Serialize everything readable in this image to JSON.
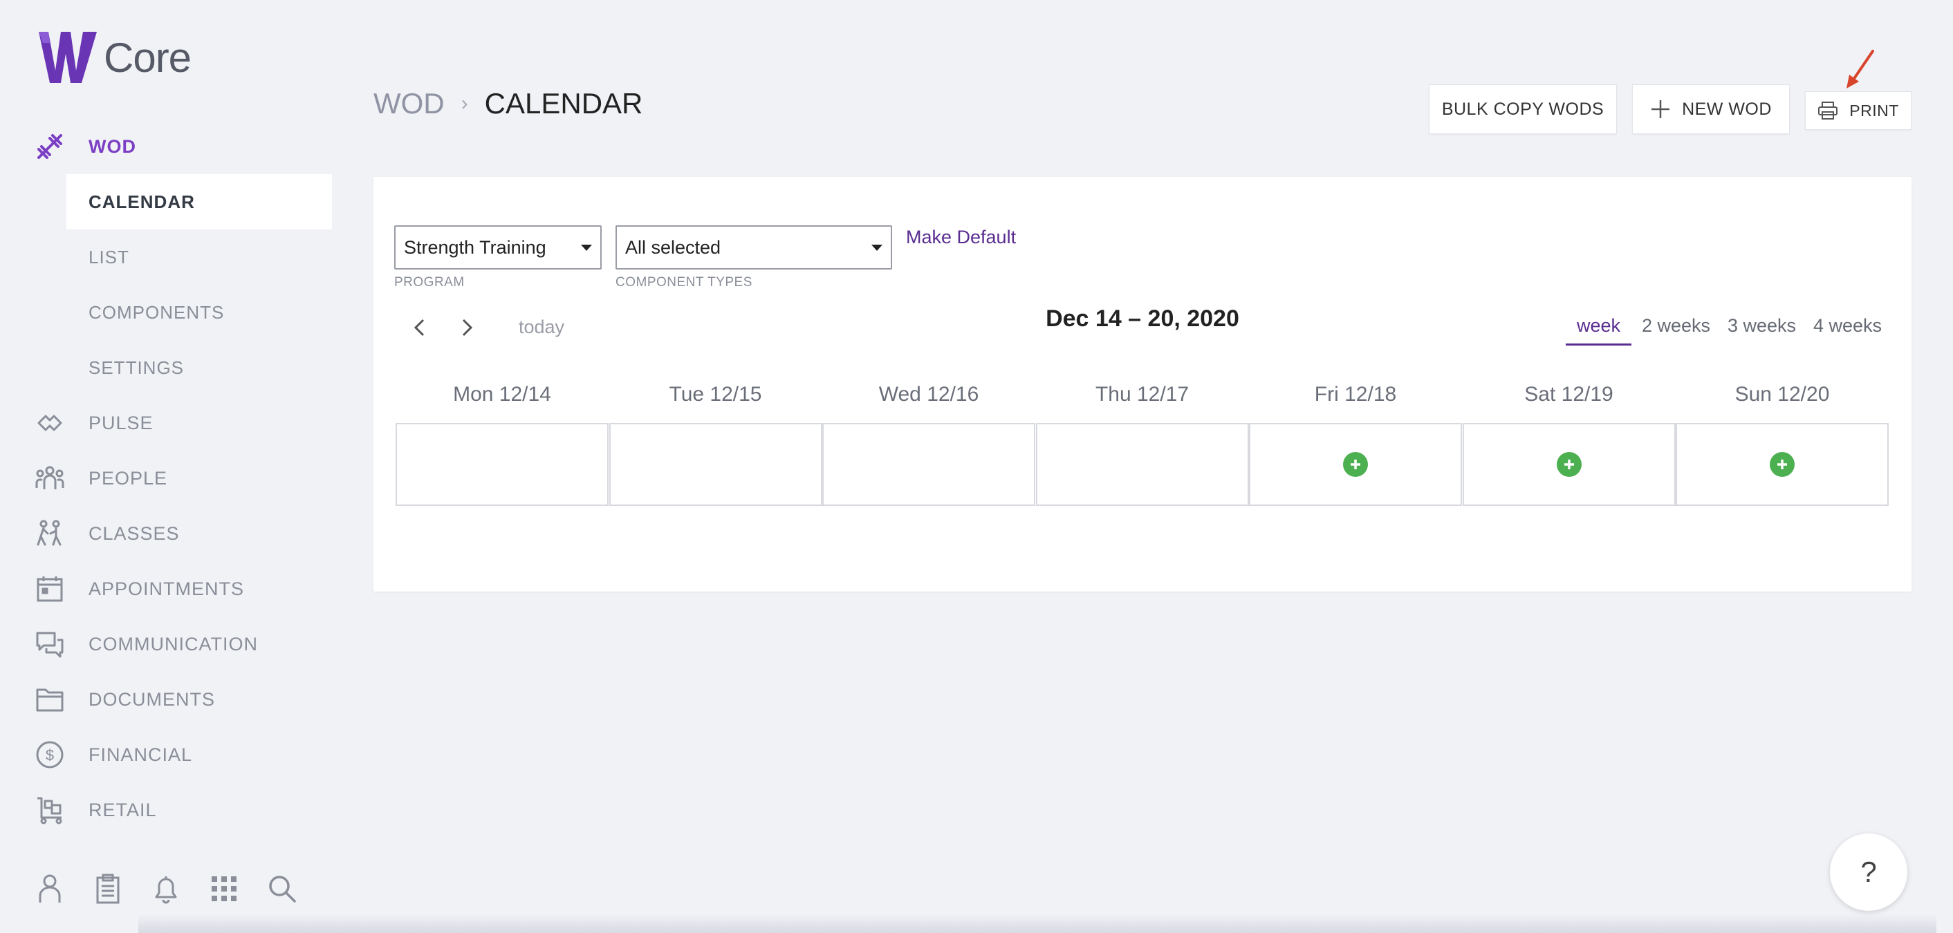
{
  "brand": {
    "name": "Core",
    "accent": "#7b3fc4"
  },
  "sidebar": {
    "wod_label": "WOD",
    "sub_items": [
      "CALENDAR",
      "LIST",
      "COMPONENTS",
      "SETTINGS"
    ],
    "items": [
      "PULSE",
      "PEOPLE",
      "CLASSES",
      "APPOINTMENTS",
      "COMMUNICATION",
      "DOCUMENTS",
      "FINANCIAL",
      "RETAIL"
    ],
    "icons": [
      "dumbbell-icon",
      "handshake-icon",
      "people-icon",
      "classes-icon",
      "calendar-icon",
      "chat-icon",
      "folder-icon",
      "dollar-icon",
      "cart-icon"
    ],
    "bottom_icons": [
      "user-icon",
      "clipboard-icon",
      "bell-icon",
      "grid-icon",
      "search-icon"
    ]
  },
  "header": {
    "breadcrumb_root": "WOD",
    "breadcrumb_sep": "›",
    "breadcrumb_current": "CALENDAR",
    "bulk_copy_label": "BULK COPY WODS",
    "new_wod_label": "NEW WOD",
    "print_label": "PRINT"
  },
  "filters": {
    "program_value": "Strength Training",
    "program_caption": "PROGRAM",
    "component_types_value": "All selected",
    "component_types_caption": "COMPONENT TYPES",
    "make_default_label": "Make Default"
  },
  "calendar": {
    "today_label": "today",
    "range_title": "Dec 14 – 20, 2020",
    "views": [
      "week",
      "2 weeks",
      "3 weeks",
      "4 weeks"
    ],
    "active_view": "week",
    "days": [
      "Mon 12/14",
      "Tue 12/15",
      "Wed 12/16",
      "Thu 12/17",
      "Fri 12/18",
      "Sat 12/19",
      "Sun 12/20"
    ],
    "add_enabled": [
      false,
      false,
      false,
      false,
      true,
      true,
      true
    ],
    "add_color": "#4caf50"
  },
  "help_label": "?"
}
